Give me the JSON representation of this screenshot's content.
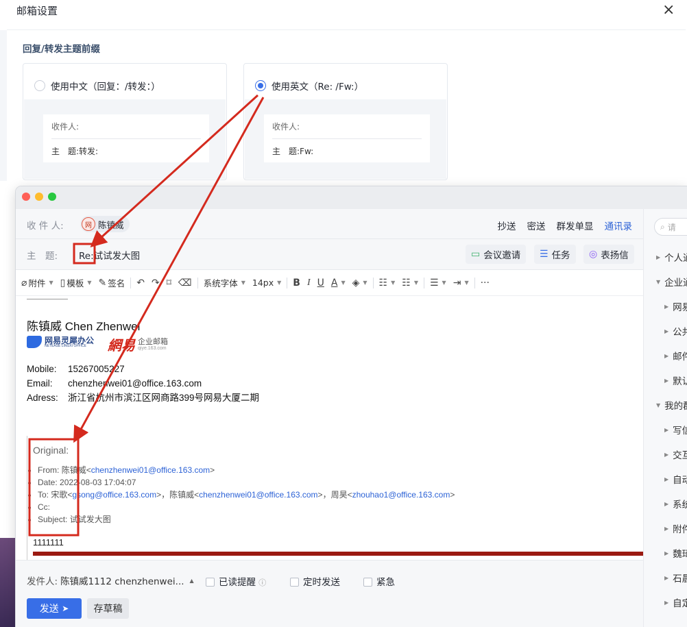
{
  "dialog": {
    "title": "邮箱设置",
    "close_label": "×",
    "section_title": "回复/转发主题前缀",
    "options": [
      {
        "label": "使用中文（回复：/转发：）",
        "selected": false,
        "preview": {
          "to_label": "收件人:",
          "subject_label": "主　题:",
          "subject_value": "转发:"
        }
      },
      {
        "label": "使用英文（Re: /Fw:）",
        "selected": true,
        "preview": {
          "to_label": "收件人:",
          "subject_label": "主　题:",
          "subject_value": "Fw:"
        }
      }
    ]
  },
  "compose": {
    "to_label": "收 件 人:",
    "recipient": "陈镇威",
    "recipient_avatar": "网",
    "header_actions": [
      "抄送",
      "密送",
      "群发单显",
      "通讯录"
    ],
    "subject_label": "主　题:",
    "subject_prefix": "Re:",
    "subject_text": "试试发大图",
    "subject_actions": [
      {
        "icon": "calendar-icon",
        "label": "会议邀请"
      },
      {
        "icon": "task-icon",
        "label": "任务"
      },
      {
        "icon": "medal-icon",
        "label": "表扬信"
      }
    ],
    "toolbar": {
      "attach": "附件",
      "template": "模板",
      "signature": "签名",
      "font": "系统字体",
      "size": "14px",
      "more": "···"
    },
    "signature": {
      "name": "陈镇威 Chen Zhenwei",
      "logo_1": "网易灵犀办公",
      "logo_1_sub": "NETEASE LINGXI OFFICE",
      "logo_2": "網易",
      "logo_2_text": "企业邮箱",
      "logo_2_sub": "qiye.163.com",
      "mobile_label": "Mobile:",
      "mobile": "15267005227",
      "email_label": "Email:",
      "email": "chenzhenwei01@office.163.com",
      "address_label": "Adress:",
      "address": "浙江省杭州市滨江区网商路399号网易大厦二期"
    },
    "original": {
      "title": "Original:",
      "from_label": "From:",
      "from_name": "陈镇威",
      "from_email": "chenzhenwei01@office.163.com",
      "date_label": "Date:",
      "date": "2022-08-03 17:04:07",
      "to_label": "To:",
      "to_1_name": "宋歌",
      "to_1_email": "gsong@office.163.com",
      "to_2_name": "，陈镇威",
      "to_2_email": "chenzhenwei01@office.163.com",
      "to_3_name": "，周昊",
      "to_3_email": "zhouhao1@office.163.com",
      "cc_label": "Cc:",
      "subject_label": "Subject:",
      "subject": "试试发大图",
      "body": "1111111"
    },
    "footer": {
      "sender_label": "发件人:",
      "sender": "陈镇威1112 chenzhenwei...",
      "read_receipt": "已读提醒",
      "scheduled": "定时发送",
      "urgent": "紧急",
      "send": "发送",
      "draft": "存草稿"
    }
  },
  "contacts_panel": {
    "search_placeholder": "请",
    "items": [
      {
        "label": "个人通",
        "level": 0,
        "expanded": false
      },
      {
        "label": "企业通",
        "level": 0,
        "expanded": true
      },
      {
        "label": "网易",
        "level": 1,
        "expanded": false
      },
      {
        "label": "公共",
        "level": 1,
        "expanded": false
      },
      {
        "label": "邮件",
        "level": 1,
        "expanded": false
      },
      {
        "label": "默认",
        "level": 1,
        "expanded": false
      },
      {
        "label": "我的群",
        "level": 0,
        "expanded": true
      },
      {
        "label": "写信",
        "level": 1,
        "expanded": false
      },
      {
        "label": "交互",
        "level": 1,
        "expanded": false
      },
      {
        "label": "自动",
        "level": 1,
        "expanded": false
      },
      {
        "label": "系统",
        "level": 1,
        "expanded": false
      },
      {
        "label": "附件",
        "level": 1,
        "expanded": false
      },
      {
        "label": "魏琦",
        "level": 1,
        "expanded": false
      },
      {
        "label": "石晨",
        "level": 1,
        "expanded": false
      },
      {
        "label": "自定",
        "level": 1,
        "expanded": false
      }
    ]
  },
  "colors": {
    "accent": "#386ee7",
    "annotation": "#d42a1e"
  }
}
